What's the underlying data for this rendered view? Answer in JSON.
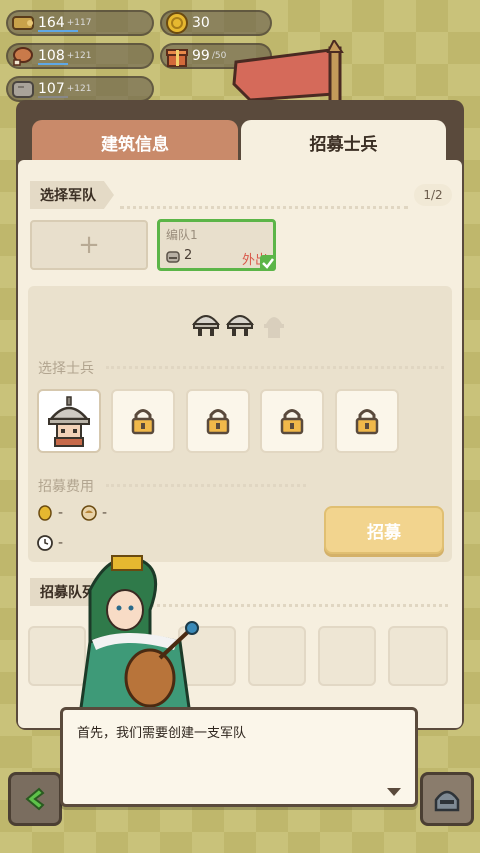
{
  "resources": [
    {
      "icon": "wood-icon",
      "value": "164",
      "delta": "+117"
    },
    {
      "icon": "coin-icon",
      "value": "30"
    },
    {
      "icon": "meat-icon",
      "value": "108",
      "delta": "+121"
    },
    {
      "icon": "gift-icon",
      "value": "99",
      "cap": "/50"
    },
    {
      "icon": "stone-icon",
      "value": "107",
      "delta": "+121"
    }
  ],
  "tabs": {
    "building_info": "建筑信息",
    "recruit_soldiers": "招募士兵"
  },
  "select_army": {
    "title": "选择军队",
    "page": "1/2",
    "add_symbol": "+",
    "team": {
      "name": "编队1",
      "count": "2",
      "status": "外出"
    }
  },
  "select_soldier": {
    "label": "选择士兵"
  },
  "cost": {
    "label": "招募费用",
    "food": "-",
    "seed": "-",
    "time": "-"
  },
  "recruit_button": "招募",
  "queue": {
    "title": "招募队列"
  },
  "dialog": {
    "text": "首先，我们需要创建一支军队"
  },
  "colors": {
    "accent_green": "#5cb548",
    "tab_active": "#f6efdf",
    "tab_inactive": "#c98a6a",
    "button": "#f2d48e"
  }
}
